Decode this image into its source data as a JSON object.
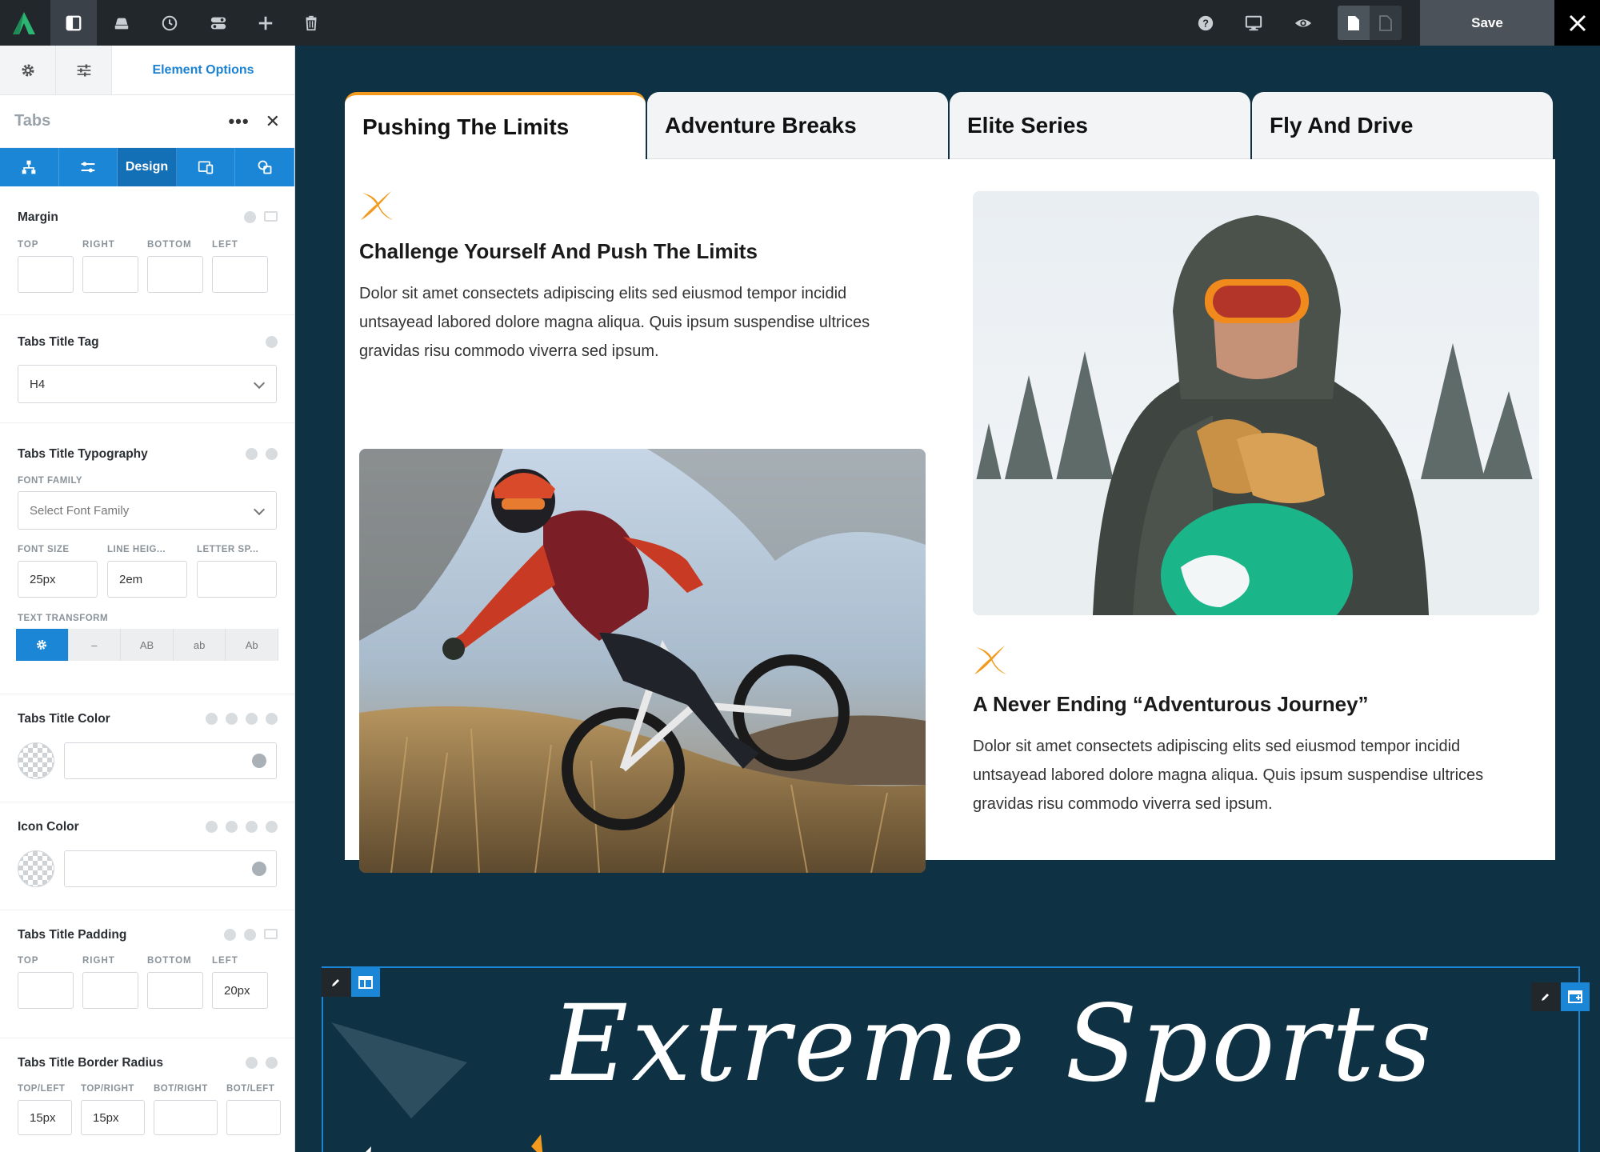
{
  "topbar": {
    "icons": [
      "logo",
      "layout-icon",
      "layers-icon",
      "history-icon",
      "toggles-icon",
      "plus-icon",
      "trash-icon",
      "help-icon",
      "desktop-icon",
      "eye-icon",
      "document-icon"
    ],
    "save_label": "Save"
  },
  "sidebar": {
    "header_title": "Element Options",
    "element_name": "Tabs",
    "design_tab_label": "Design",
    "margin": {
      "title": "Margin",
      "labels": [
        "TOP",
        "RIGHT",
        "BOTTOM",
        "LEFT"
      ],
      "values": [
        "",
        "",
        "",
        ""
      ]
    },
    "title_tag": {
      "title": "Tabs Title Tag",
      "value": "H4"
    },
    "typography": {
      "title": "Tabs Title Typography",
      "font_family_label": "FONT FAMILY",
      "font_family_placeholder": "Select Font Family",
      "font_size_label": "FONT SIZE",
      "font_size": "25px",
      "line_height_label": "LINE HEIG...",
      "line_height": "2em",
      "letter_spacing_label": "LETTER SP...",
      "letter_spacing": "",
      "text_transform_label": "TEXT TRANSFORM",
      "text_transform_options": [
        "–",
        "AB",
        "ab",
        "Ab"
      ]
    },
    "title_color": {
      "title": "Tabs Title Color",
      "value": ""
    },
    "icon_color": {
      "title": "Icon Color",
      "value": ""
    },
    "padding": {
      "title": "Tabs Title Padding",
      "labels": [
        "TOP",
        "RIGHT",
        "BOTTOM",
        "LEFT"
      ],
      "values": [
        "",
        "",
        "",
        "20px"
      ]
    },
    "border_radius": {
      "title": "Tabs Title Border Radius",
      "labels": [
        "TOP/LEFT",
        "TOP/RIGHT",
        "BOT/RIGHT",
        "BOT/LEFT"
      ],
      "values": [
        "15px",
        "15px",
        "",
        ""
      ]
    }
  },
  "canvas": {
    "tabs": [
      "Pushing The Limits",
      "Adventure Breaks",
      "Elite Series",
      "Fly And Drive"
    ],
    "active_tab": 0,
    "left_block": {
      "heading": "Challenge Yourself And Push The Limits",
      "text": "Dolor sit amet consectets adipiscing elits sed eiusmod tempor incidid untsayead labored dolore magna aliqua. Quis ipsum suspendise ultrices gravidas risu commodo viverra sed ipsum."
    },
    "right_block": {
      "heading": "A Never Ending “Adventurous Journey”",
      "text": "Dolor sit amet consectets adipiscing elits sed eiusmod tempor incidid untsayead labored dolore magna aliqua. Quis ipsum suspendise ultrices gravidas risu commodo viverra sed ipsum."
    },
    "bottom_title": "Extreme Sports"
  },
  "colors": {
    "canvas_bg": "#0e3143",
    "accent_blue": "#1b86d6",
    "tab_accent_orange": "#f19a1d",
    "toolbar_bg": "#22272c"
  }
}
